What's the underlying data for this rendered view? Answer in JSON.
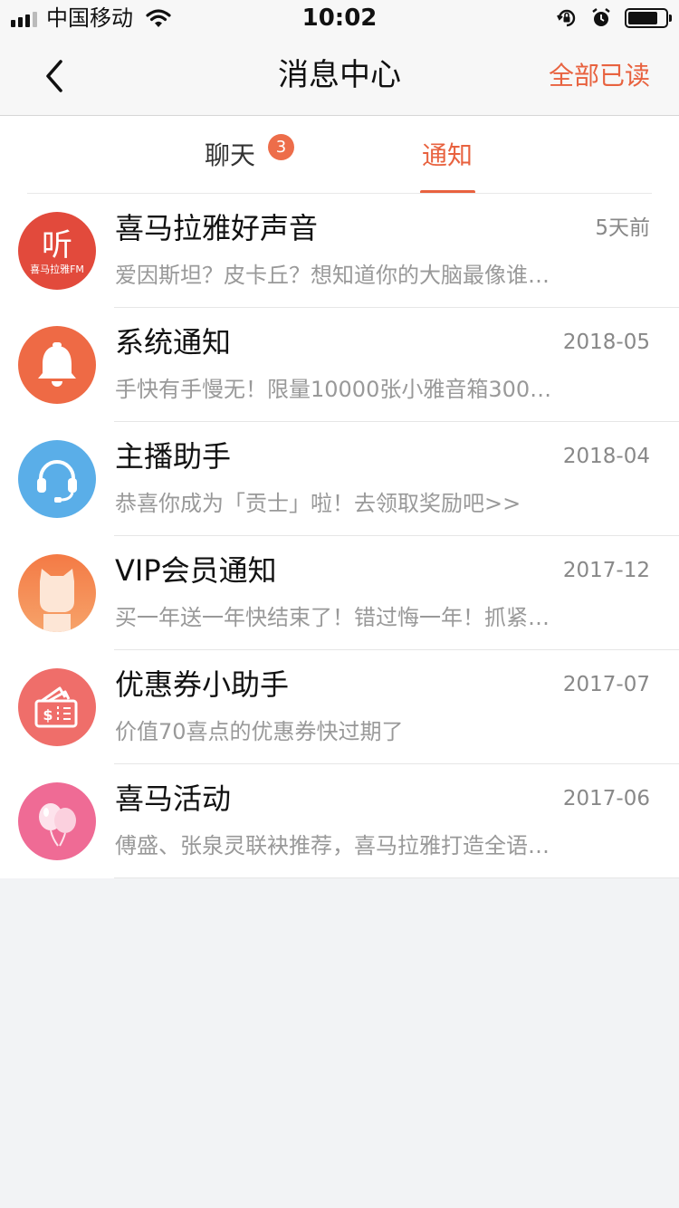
{
  "status_bar": {
    "carrier": "中国移动",
    "time": "10:02",
    "icons": [
      "signal-icon",
      "wifi-icon",
      "rotation-lock-icon",
      "alarm-icon",
      "battery-icon"
    ],
    "battery_level": 0.8
  },
  "nav": {
    "title": "消息中心",
    "mark_all_read": "全部已读",
    "back_icon": "chevron-left-icon"
  },
  "tabs": {
    "items": [
      {
        "label": "聊天",
        "badge": "3",
        "active": false
      },
      {
        "label": "通知",
        "active": true
      }
    ]
  },
  "colors": {
    "accent": "#e8623f",
    "background": "#f2f3f5"
  },
  "messages": [
    {
      "title": "喜马拉雅好声音",
      "time": "5天前",
      "preview": "爱因斯坦？皮卡丘？想知道你的大脑最像谁…",
      "avatar_icon": "ting-logo-icon",
      "avatar_text": "听",
      "avatar_subtext": "喜马拉雅FM",
      "avatar_color": "#e24a3c"
    },
    {
      "title": "系统通知",
      "time": "2018-05",
      "preview": "手快有手慢无！限量10000张小雅音箱300…",
      "avatar_icon": "bell-icon",
      "avatar_color": "#ee6a45"
    },
    {
      "title": "主播助手",
      "time": "2018-04",
      "preview": "恭喜你成为「贡士」啦！去领取奖励吧>>",
      "avatar_icon": "headset-icon",
      "avatar_color": "#5aaee8"
    },
    {
      "title": "VIP会员通知",
      "time": "2017-12",
      "preview": "买一年送一年快结束了！错过悔一年！抓紧…",
      "avatar_icon": "cat-icon",
      "avatar_color": "#f3894d"
    },
    {
      "title": "优惠券小助手",
      "time": "2017-07",
      "preview": "价值70喜点的优惠券快过期了",
      "avatar_icon": "coupon-icon",
      "avatar_color": "#ef6e6a"
    },
    {
      "title": "喜马活动",
      "time": "2017-06",
      "preview": "傅盛、张泉灵联袂推荐，喜马拉雅打造全语…",
      "avatar_icon": "balloons-icon",
      "avatar_color": "#ef6b95"
    }
  ]
}
